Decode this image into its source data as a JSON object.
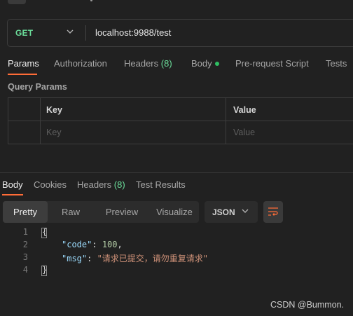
{
  "request": {
    "method": "GET",
    "url": "localhost:9988/test"
  },
  "request_tabs": [
    {
      "label": "Params",
      "active": true
    },
    {
      "label": "Authorization"
    },
    {
      "label": "Headers",
      "count": "(8)"
    },
    {
      "label": "Body",
      "indicator": "green-dot"
    },
    {
      "label": "Pre-request Script"
    },
    {
      "label": "Tests"
    }
  ],
  "query_params": {
    "title": "Query Params",
    "columns": [
      "Key",
      "Value"
    ],
    "placeholder_key": "Key",
    "placeholder_value": "Value"
  },
  "response_tabs": [
    {
      "label": "Body",
      "active": true
    },
    {
      "label": "Cookies"
    },
    {
      "label": "Headers",
      "count": "(8)"
    },
    {
      "label": "Test Results"
    }
  ],
  "view_modes": [
    {
      "label": "Pretty",
      "active": true
    },
    {
      "label": "Raw"
    },
    {
      "label": "Preview"
    },
    {
      "label": "Visualize"
    }
  ],
  "format_select": {
    "value": "JSON"
  },
  "code_lines": [
    {
      "n": "1",
      "text": "{"
    },
    {
      "n": "2",
      "key": "\"code\"",
      "sep": ": ",
      "value": "100",
      "end": ","
    },
    {
      "n": "3",
      "key": "\"msg\"",
      "sep": ": ",
      "value": "\"请求已提交，请勿重复请求\""
    },
    {
      "n": "4",
      "text": "}"
    }
  ],
  "watermark": "CSDN @Bummon.",
  "colors": {
    "background": "#212121",
    "accent": "#ff6c37",
    "method_green": "#6bdd9a",
    "json_key": "#9cdcfe",
    "json_number": "#b5cea8",
    "json_string": "#ce9178"
  },
  "icons": [
    "back-arrow-icon",
    "chevron-down-icon",
    "wrap-lines-icon"
  ]
}
